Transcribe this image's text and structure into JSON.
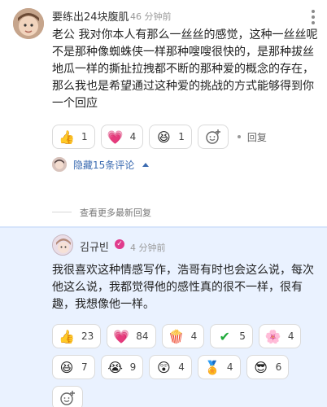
{
  "comment1": {
    "author": "要练出24块腹肌",
    "time": "46 分钟前",
    "text": "老公 我对你本人有那么一丝丝的感觉，这种一丝丝呢不是那种像蜘蛛侠一样那种嗖嗖很快的，是那种拔丝地瓜一样的撕扯拉拽都不断的那种爱的概念的存在，那么我也是希望通过这种爱的挑战的方式能够得到你一个回应",
    "reactions": [
      {
        "icon": "thumbs-up-icon",
        "glyph": "👍",
        "count": "1"
      },
      {
        "icon": "heart-icon",
        "glyph": "💗",
        "count": "4"
      },
      {
        "icon": "laughing-ghost-icon",
        "glyph": "😆",
        "count": "1"
      }
    ],
    "reply_label": "回复",
    "hidden_replies": "隐藏15条评论"
  },
  "more_replies_label": "查看更多最新回复",
  "comment2": {
    "author": "김규빈",
    "time": "4 分钟前",
    "text": "我很喜欢这种情感写作，浩哥有时也会这么说，每次他这么说，我都觉得他的感性真的很不一样，很有趣，我想像他一样。",
    "reactions": [
      {
        "icon": "thumbs-up-icon",
        "glyph": "👍",
        "count": "23"
      },
      {
        "icon": "heart-icon",
        "glyph": "💗",
        "count": "84"
      },
      {
        "icon": "popcorn-icon",
        "glyph": "🍿",
        "count": "4"
      },
      {
        "icon": "check-icon",
        "glyph": "✔",
        "count": "5"
      },
      {
        "icon": "flower-icon",
        "glyph": "🌸",
        "count": "4"
      },
      {
        "icon": "laughing-face-icon",
        "glyph": "😆",
        "count": "7"
      },
      {
        "icon": "crying-face-icon",
        "glyph": "😭",
        "count": "9"
      },
      {
        "icon": "surprised-ghost-icon",
        "glyph": "😲",
        "count": "4"
      },
      {
        "icon": "medal-icon",
        "glyph": "🏅",
        "count": "4"
      },
      {
        "icon": "cool-face-icon",
        "glyph": "😎",
        "count": "6"
      }
    ]
  },
  "colors": {
    "link_blue": "#3a6ab0",
    "highlight_bg": "#eaf2ff",
    "verify_pink": "#e03b8c"
  }
}
